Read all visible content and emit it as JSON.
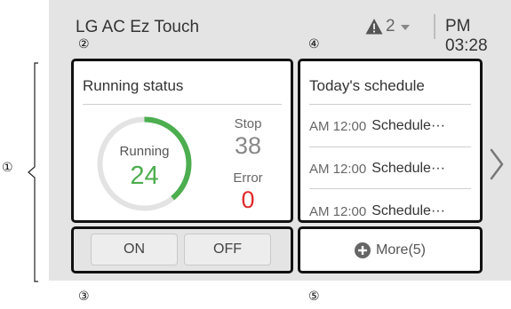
{
  "header": {
    "title": "LG AC Ez Touch",
    "alert_count": "2",
    "time": "PM 03:28"
  },
  "callouts": [
    "①",
    "②",
    "③",
    "④",
    "⑤"
  ],
  "status": {
    "title": "Running status",
    "running_label": "Running",
    "running_value": "24",
    "running_fraction": 0.39,
    "stop_label": "Stop",
    "stop_value": "38",
    "error_label": "Error",
    "error_value": "0"
  },
  "schedule": {
    "title": "Today's schedule",
    "items": [
      {
        "time": "AM 12:00",
        "name": "Schedule···"
      },
      {
        "time": "AM 12:00",
        "name": "Schedule···"
      },
      {
        "time": "AM 12:00",
        "name": "Schedule···"
      }
    ]
  },
  "controls": {
    "on_label": "ON",
    "off_label": "OFF"
  },
  "more": {
    "label": "More(5)"
  },
  "icons": {
    "alert": "warning-icon",
    "more": "plus-circle-icon",
    "next": "chevron-right-icon"
  },
  "colors": {
    "running_green": "#4cae4f",
    "error_red": "#e12a2a",
    "track_gray": "#e3e3e3"
  }
}
